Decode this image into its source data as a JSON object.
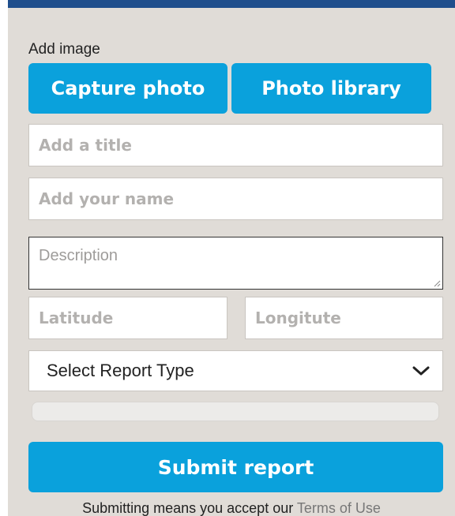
{
  "form": {
    "add_image_label": "Add image",
    "capture_button": "Capture photo",
    "library_button": "Photo library",
    "title_placeholder": "Add a title",
    "title_value": "",
    "name_placeholder": "Add your name",
    "name_value": "",
    "description_placeholder": "Description",
    "description_value": "",
    "latitude_placeholder": "Latitude",
    "latitude_value": "",
    "longitude_placeholder": "Longitute",
    "longitude_value": "",
    "report_type_selected": "Select Report Type",
    "upload_progress": 0,
    "submit_button": "Submit report",
    "footer_text": "Submitting means you accept our ",
    "terms_link": "Terms of Use"
  },
  "icons": {
    "report_type_toggle": "chevron-down-icon",
    "description_resize": "resize-grip-icon"
  },
  "colors": {
    "header_bar": "#1f4e8c",
    "accent": "#0aa1dc",
    "background": "#e0dcd7"
  }
}
